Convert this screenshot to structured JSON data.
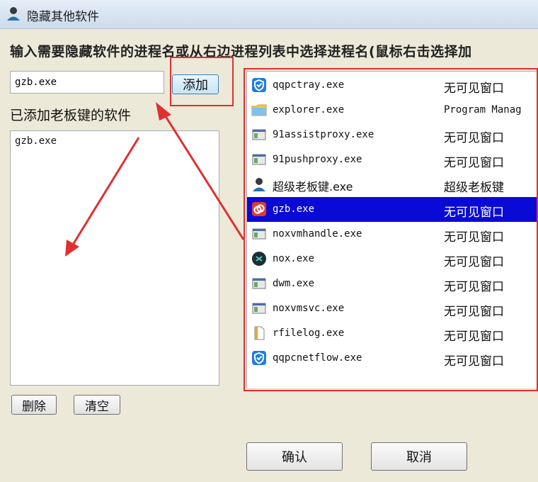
{
  "window": {
    "title": "隐藏其他软件"
  },
  "prompt": "输入需要隐藏软件的进程名或从右边进程列表中选择进程名(鼠标右击选择加",
  "name_input": {
    "value": "gzb.exe"
  },
  "add_button": "添加",
  "added_label": "已添加老板键的软件",
  "added_items": [
    "gzb.exe"
  ],
  "delete_button": "删除",
  "clear_button": "清空",
  "ok_button": "确认",
  "cancel_button": "取消",
  "processes": [
    {
      "name": "qqpctray.exe",
      "status": "无可见窗口",
      "icon": "shield-icon"
    },
    {
      "name": "explorer.exe",
      "status": "Program Manag",
      "icon": "folder-icon"
    },
    {
      "name": "91assistproxy.exe",
      "status": "无可见窗口",
      "icon": "exe-icon"
    },
    {
      "name": "91pushproxy.exe",
      "status": "无可见窗口",
      "icon": "exe-icon"
    },
    {
      "name": "超级老板键.exe",
      "status": "超级老板键",
      "icon": "user-icon"
    },
    {
      "name": "gzb.exe",
      "status": "无可见窗口",
      "icon": "gzb-icon",
      "selected": true
    },
    {
      "name": "noxvmhandle.exe",
      "status": "无可见窗口",
      "icon": "exe-icon"
    },
    {
      "name": "nox.exe",
      "status": "无可见窗口",
      "icon": "nox-icon"
    },
    {
      "name": "dwm.exe",
      "status": "无可见窗口",
      "icon": "exe-icon"
    },
    {
      "name": "noxvmsvc.exe",
      "status": "无可见窗口",
      "icon": "exe-icon"
    },
    {
      "name": "rfilelog.exe",
      "status": "无可见窗口",
      "icon": "file-icon"
    },
    {
      "name": "qqpcnetflow.exe",
      "status": "无可见窗口",
      "icon": "shield-icon"
    }
  ],
  "colors": {
    "selection": "#0a0ad6",
    "annotation": "#e03030"
  }
}
